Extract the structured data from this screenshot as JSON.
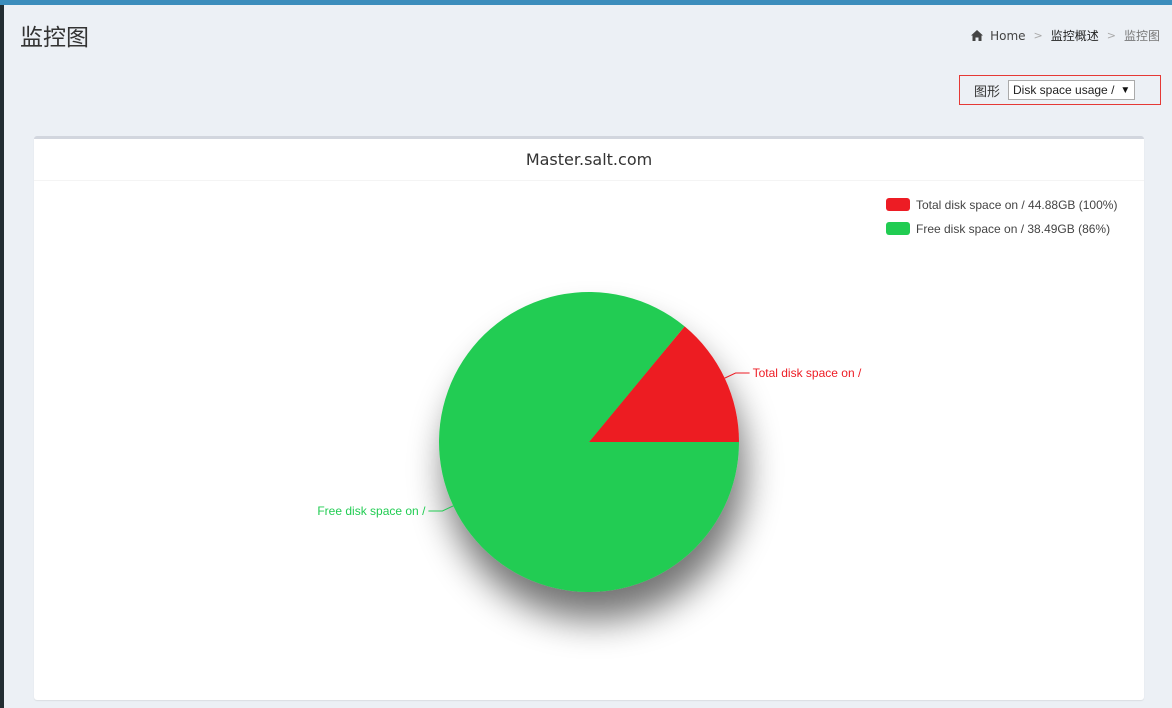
{
  "page": {
    "title": "监控图"
  },
  "breadcrumb": {
    "home": "Home",
    "overview": "监控概述",
    "current": "监控图",
    "separator": ">"
  },
  "selector": {
    "label": "图形",
    "selected": "Disk space usage /"
  },
  "colors": {
    "accent": "#3c8dbc",
    "total": "#ed1c24",
    "free": "#21cc52"
  },
  "chart_data": {
    "type": "pie",
    "title": "Master.salt.com",
    "legend_position": "top-right",
    "legend": [
      {
        "label": "Total disk space on / 44.88GB (100%)",
        "color": "#ed1c24"
      },
      {
        "label": "Free disk space on / 38.49GB (86%)",
        "color": "#21cc52"
      }
    ],
    "slices": [
      {
        "name": "Total disk space on /",
        "value": 14,
        "color": "#ed1c24",
        "label": "Total disk space on /"
      },
      {
        "name": "Free disk space on /",
        "value": 86,
        "color": "#21cc52",
        "label": "Free disk space on /"
      }
    ]
  }
}
